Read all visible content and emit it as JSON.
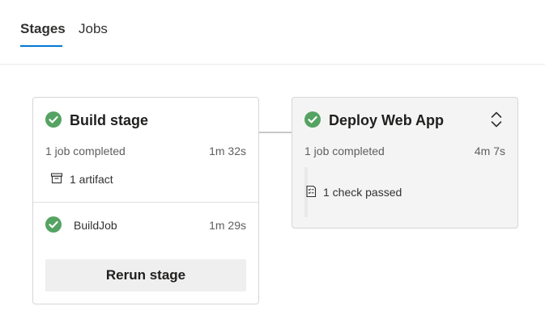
{
  "tabs": [
    {
      "label": "Stages",
      "active": true
    },
    {
      "label": "Jobs",
      "active": false
    }
  ],
  "build_stage": {
    "title": "Build stage",
    "status_text": "1 job completed",
    "duration": "1m 32s",
    "artifact_text": "1 artifact",
    "jobs": [
      {
        "name": "BuildJob",
        "duration": "1m 29s"
      }
    ],
    "rerun_label": "Rerun stage"
  },
  "deploy_stage": {
    "title": "Deploy Web App",
    "status_text": "1 job completed",
    "duration": "4m 7s",
    "checks_text": "1 check passed"
  },
  "colors": {
    "success": "#55a362",
    "accent": "#0078d4"
  },
  "icons": [
    "check-circle-icon",
    "artifact-icon",
    "checklist-icon",
    "expand-collapse-icon"
  ]
}
